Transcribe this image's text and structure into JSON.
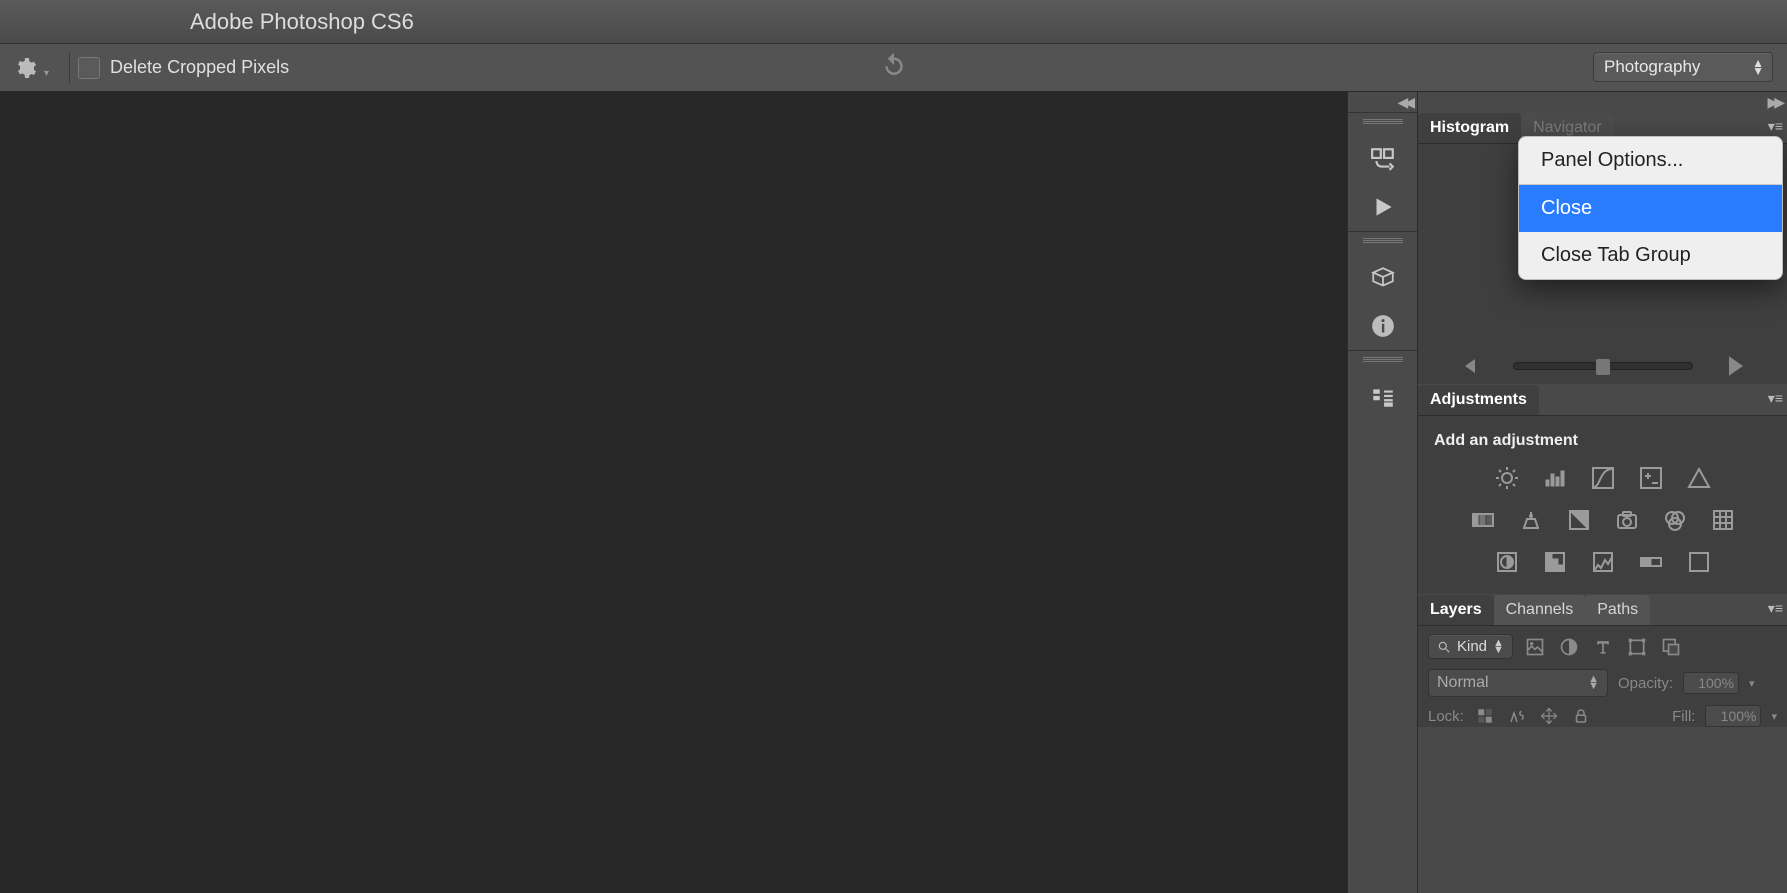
{
  "titlebar": {
    "title": "Adobe Photoshop CS6"
  },
  "optionsbar": {
    "delete_cropped_label": "Delete Cropped Pixels",
    "workspace_selected": "Photography"
  },
  "dock": {
    "collapse_glyph": "◀◀"
  },
  "panels_top": {
    "expand_glyph": "▶▶"
  },
  "histogram_panel": {
    "tabs": [
      "Histogram",
      "Navigator"
    ],
    "active": 0
  },
  "popup": {
    "items": [
      "Panel Options...",
      "Close",
      "Close Tab Group"
    ],
    "highlighted_index": 1
  },
  "adjustments_panel": {
    "tab": "Adjustments",
    "subtitle": "Add an adjustment"
  },
  "layers_panel": {
    "tabs": [
      "Layers",
      "Channels",
      "Paths"
    ],
    "active": 0,
    "kind_label": "Kind",
    "blend_mode": "Normal",
    "opacity_label": "Opacity:",
    "opacity_value": "100%",
    "fill_label": "Fill:",
    "fill_value": "100%",
    "lock_label": "Lock:"
  }
}
